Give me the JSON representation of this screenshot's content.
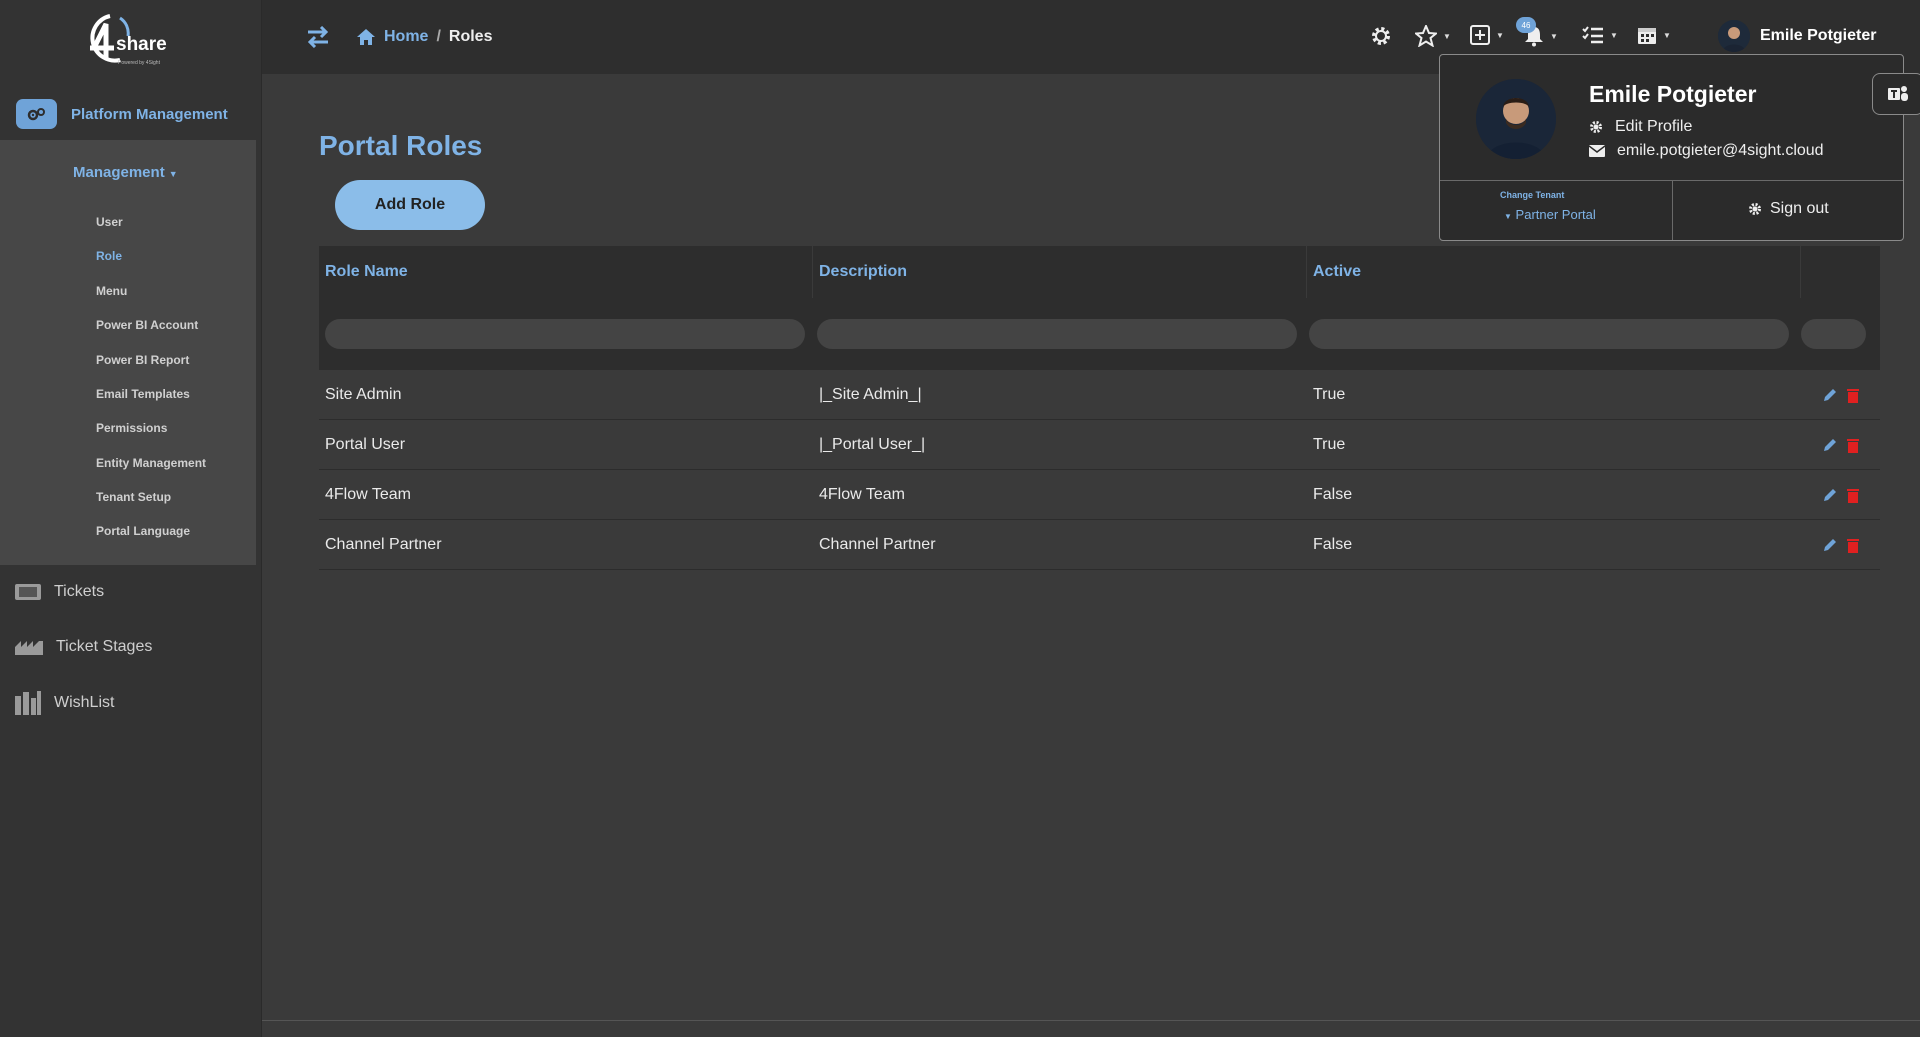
{
  "logo": {
    "brand": "share",
    "tagline": "Powered by 4Sight"
  },
  "sidebar": {
    "platform_label": "Platform Management",
    "management_label": "Management",
    "sub_items": [
      {
        "label": "User",
        "active": false
      },
      {
        "label": "Role",
        "active": true
      },
      {
        "label": "Menu",
        "active": false
      },
      {
        "label": "Power BI Account",
        "active": false
      },
      {
        "label": "Power BI Report",
        "active": false
      },
      {
        "label": "Email Templates",
        "active": false
      },
      {
        "label": "Permissions",
        "active": false
      },
      {
        "label": "Entity Management",
        "active": false
      },
      {
        "label": "Tenant Setup",
        "active": false
      },
      {
        "label": "Portal Language",
        "active": false
      }
    ],
    "nav_items": [
      {
        "label": "Tickets",
        "icon": "ticket-icon"
      },
      {
        "label": "Ticket Stages",
        "icon": "stages-icon"
      },
      {
        "label": "WishList",
        "icon": "wishlist-icon"
      }
    ]
  },
  "header": {
    "breadcrumb_home": "Home",
    "breadcrumb_sep": "/",
    "breadcrumb_current": "Roles",
    "notification_count": "46",
    "user_name": "Emile Potgieter"
  },
  "main": {
    "title": "Portal Roles",
    "add_button": "Add Role",
    "columns": [
      "Role Name",
      "Description",
      "Active"
    ],
    "rows": [
      {
        "name": "Site Admin",
        "description": "|_Site Admin_|",
        "active": "True"
      },
      {
        "name": "Portal User",
        "description": "|_Portal User_|",
        "active": "True"
      },
      {
        "name": "4Flow Team",
        "description": "4Flow Team",
        "active": "False"
      },
      {
        "name": "Channel Partner",
        "description": "Channel Partner",
        "active": "False"
      }
    ]
  },
  "profile": {
    "name": "Emile Potgieter",
    "edit_profile": "Edit Profile",
    "email": "emile.potgieter@4sight.cloud",
    "change_tenant_label": "Change Tenant",
    "tenant": "Partner Portal",
    "sign_out": "Sign out"
  },
  "colors": {
    "accent": "#7fb3e6",
    "button": "#8bbde9",
    "delete": "#e02020",
    "edit": "#6fa3d8"
  }
}
